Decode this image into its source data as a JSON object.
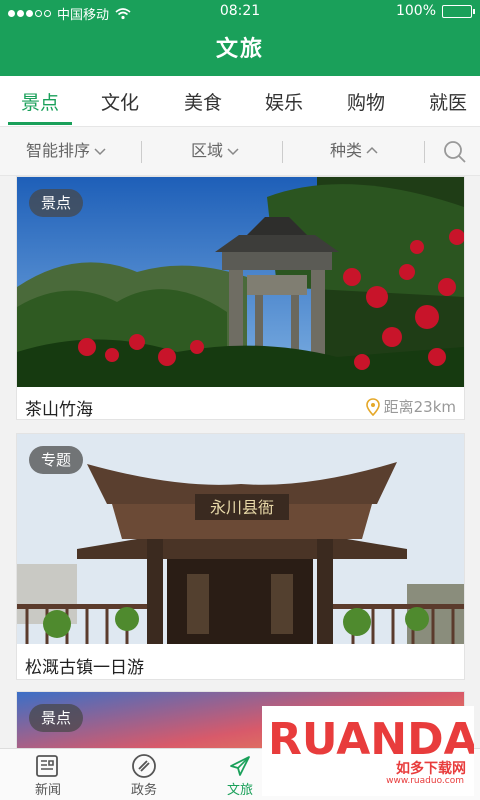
{
  "status_bar": {
    "carrier": "中国移动",
    "time": "08:21",
    "battery": "100%"
  },
  "header": {
    "title": "文旅"
  },
  "tabs": [
    {
      "label": "景点",
      "active": true
    },
    {
      "label": "文化",
      "active": false
    },
    {
      "label": "美食",
      "active": false
    },
    {
      "label": "娱乐",
      "active": false
    },
    {
      "label": "购物",
      "active": false
    },
    {
      "label": "就医",
      "active": false
    }
  ],
  "filters": {
    "sort": "智能排序",
    "region": "区域",
    "category": "种类"
  },
  "cards": [
    {
      "badge": "景点",
      "title": "茶山竹海",
      "distance": "距离23km"
    },
    {
      "badge": "专题",
      "title": "松溉古镇一日游",
      "gate_sign": "永川县衙"
    },
    {
      "badge": "景点"
    }
  ],
  "bottom_nav": [
    {
      "label": "新闻",
      "icon": "newspaper-icon",
      "active": false
    },
    {
      "label": "政务",
      "icon": "badge-icon",
      "active": false
    },
    {
      "label": "文旅",
      "icon": "airplane-icon",
      "active": true
    }
  ],
  "watermark": {
    "logo": "RUANDADO",
    "name": "如多下载网",
    "url": "www.ruaduo.com"
  },
  "colors": {
    "brand": "#1aa05a",
    "accent_red": "#e83c3c"
  }
}
